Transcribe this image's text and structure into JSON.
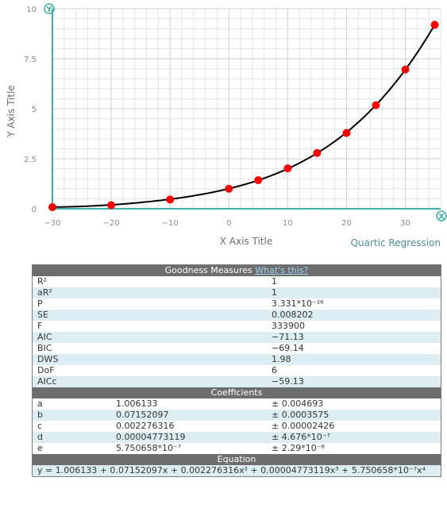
{
  "chart_data": {
    "type": "scatter",
    "xlabel": "X Axis Title",
    "ylabel": "Y Axis Title",
    "xlim": [
      -30,
      36
    ],
    "ylim": [
      0,
      10
    ],
    "x_ticks": [
      -30,
      -20,
      -10,
      0,
      10,
      20,
      30
    ],
    "x_tick_labels": [
      "−30",
      "−20",
      "−10",
      "0",
      "10",
      "20",
      "30"
    ],
    "y_ticks": [
      0,
      2.5,
      5,
      7.5,
      10
    ],
    "y_tick_labels": [
      "0",
      "2.5",
      "5",
      "7.5",
      "10"
    ],
    "grid": true,
    "points": [
      {
        "x": -30,
        "y": 0.08
      },
      {
        "x": -20,
        "y": 0.18
      },
      {
        "x": -10,
        "y": 0.46
      },
      {
        "x": 0,
        "y": 1.0
      },
      {
        "x": 5,
        "y": 1.43
      },
      {
        "x": 10,
        "y": 2.02
      },
      {
        "x": 15,
        "y": 2.79
      },
      {
        "x": 20,
        "y": 3.79
      },
      {
        "x": 25,
        "y": 5.18
      },
      {
        "x": 30,
        "y": 6.96
      },
      {
        "x": 35,
        "y": 9.2
      }
    ],
    "fit_coefficients": [
      1.006133,
      0.07152097,
      0.002276316,
      4.773119e-05,
      5.750658e-07
    ],
    "point_color": "#ff0000",
    "line_color": "#000000",
    "grid_color": "#e3e3e3"
  },
  "axis_badges": {
    "y": "Y",
    "x": "X",
    "color": "#3fb0a8"
  },
  "regression_label": "Quartic Regression",
  "goodness": {
    "title": "Goodness Measures",
    "link": "What's this?",
    "rows": [
      {
        "name": "R²",
        "value": "1"
      },
      {
        "name": "aR²",
        "value": "1"
      },
      {
        "name": "P",
        "value": "3.331*10⁻¹⁶"
      },
      {
        "name": "SE",
        "value": "0.008202"
      },
      {
        "name": "F",
        "value": "333900"
      },
      {
        "name": "AIC",
        "value": "−71.13"
      },
      {
        "name": "BIC",
        "value": "−69.14"
      },
      {
        "name": "DWS",
        "value": "1.98"
      },
      {
        "name": "DoF",
        "value": "6"
      },
      {
        "name": "AICc",
        "value": "−59.13"
      }
    ]
  },
  "coefficients": {
    "title": "Coefficients",
    "rows": [
      {
        "name": "a",
        "value": "1.006133",
        "error": "± 0.004693"
      },
      {
        "name": "b",
        "value": "0.07152097",
        "error": "± 0.0003575"
      },
      {
        "name": "c",
        "value": "0.002276316",
        "error": "± 0.00002426"
      },
      {
        "name": "d",
        "value": "0.00004773119",
        "error": "± 4.676*10⁻⁷"
      },
      {
        "name": "e",
        "value": "5.750658*10⁻⁷",
        "error": "± 2.29*10⁻⁸"
      }
    ]
  },
  "equation": {
    "title": "Equation",
    "text": "y = 1.006133 + 0.07152097x + 0.002276316x² + 0.00004773119x³ + 5.750658*10⁻⁷x⁴"
  }
}
